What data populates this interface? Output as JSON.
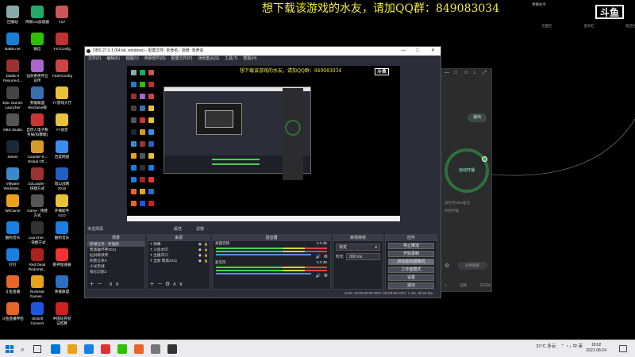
{
  "desktop": {
    "icons": [
      {
        "label": "回收站",
        "col": 0,
        "row": 0,
        "color": "#8aa"
      },
      {
        "label": "网易UU加速器",
        "col": 1,
        "row": 0,
        "color": "#2a6"
      },
      {
        "label": "YS7",
        "col": 2,
        "row": 0,
        "color": "#c55"
      },
      {
        "label": "Battle.net",
        "col": 0,
        "row": 1,
        "color": "#1a7fd4"
      },
      {
        "label": "微信",
        "col": 1,
        "row": 1,
        "color": "#2dc100"
      },
      {
        "label": "YS7Config",
        "col": 2,
        "row": 1,
        "color": "#b33"
      },
      {
        "label": "Diablo II\nResurrect...",
        "col": 0,
        "row": 2,
        "color": "#933"
      },
      {
        "label": "仙剑奇侠传五\n前传",
        "col": 1,
        "row": 2,
        "color": "#a6c"
      },
      {
        "label": "YSSHConfig",
        "col": 2,
        "row": 2,
        "color": "#c44"
      },
      {
        "label": "Epic Games\nLauncher",
        "col": 0,
        "row": 3,
        "color": "#444"
      },
      {
        "label": "英雄联盟\nWeGame版",
        "col": 1,
        "row": 3,
        "color": "#3a6fb0"
      },
      {
        "label": "YY游戏大厅",
        "col": 2,
        "row": 3,
        "color": "#e8c23a"
      },
      {
        "label": "OBS Studio",
        "col": 0,
        "row": 4,
        "color": "#555"
      },
      {
        "label": "自然人电子税\n务局(扣缴端)",
        "col": 1,
        "row": 4,
        "color": "#c33"
      },
      {
        "label": "YY语音",
        "col": 2,
        "row": 4,
        "color": "#e8c23a"
      },
      {
        "label": "Steam",
        "col": 0,
        "row": 5,
        "color": "#1b2838"
      },
      {
        "label": "Counter-S...\nGlobal Off...",
        "col": 1,
        "row": 5,
        "color": "#d99a2b"
      },
      {
        "label": "百度网盘",
        "col": 2,
        "row": 5,
        "color": "#3b8ef0"
      },
      {
        "label": "VMware\nWorkstati...",
        "col": 0,
        "row": 6,
        "color": "#3a8acb"
      },
      {
        "label": "D2Loader -\n快捷方式",
        "col": 1,
        "row": 6,
        "color": "#933"
      },
      {
        "label": "暗山战网\n2016",
        "col": 2,
        "row": 6,
        "color": "#2060c0"
      },
      {
        "label": "WeGame",
        "col": 0,
        "row": 7,
        "color": "#e8a31a"
      },
      {
        "label": "Game - 快捷\n方式",
        "col": 1,
        "row": 7,
        "color": "#555"
      },
      {
        "label": "开播助手\nV3.0",
        "col": 2,
        "row": 7,
        "color": "#e8c23a"
      },
      {
        "label": "酷狗音乐",
        "col": 0,
        "row": 8,
        "color": "#1a7fe0"
      },
      {
        "label": "Launcher...\n- 快捷方式",
        "col": 1,
        "row": 8,
        "color": "#333"
      },
      {
        "label": "酷狗音乐",
        "col": 2,
        "row": 8,
        "color": "#1a7fe0"
      },
      {
        "label": "钉钉",
        "col": 0,
        "row": 9,
        "color": "#1a7fe0"
      },
      {
        "label": "Red Dead\nRedempt...",
        "col": 1,
        "row": 9,
        "color": "#a22"
      },
      {
        "label": "雷神加速器",
        "col": 2,
        "row": 9,
        "color": "#e33"
      },
      {
        "label": "斗鱼直播",
        "col": 0,
        "row": 10,
        "color": "#e8652a"
      },
      {
        "label": "Rockstar\nGames...",
        "col": 1,
        "row": 10,
        "color": "#e8a31a"
      },
      {
        "label": "英雄联盟",
        "col": 2,
        "row": 10,
        "color": "#2a6fc0"
      },
      {
        "label": "斗鱼直播伴侣",
        "col": 0,
        "row": 11,
        "color": "#e8652a"
      },
      {
        "label": "Ubisoft\nConnect",
        "col": 1,
        "row": 11,
        "color": "#2255dd"
      },
      {
        "label": "中国证券登\n记结算",
        "col": 2,
        "row": 11,
        "color": "#c22"
      }
    ],
    "banner": "想下载该游戏的水友，请加QQ群：849083034",
    "sidebar": {
      "title": "弹幕助手",
      "links": [
        "页面栏",
        "查询栏",
        "粘连栏"
      ]
    },
    "logo": "斗鱼"
  },
  "side_panel": {
    "controls": [
      "—",
      "□",
      "☺",
      "♪",
      "⤢"
    ],
    "exit_button": "退出",
    "start_button": "自动开播",
    "sub1": "请打开OBS推流",
    "sub2": "开始开播",
    "share_button": "分享链接",
    "footer": [
      "≡",
      "提醒",
      "开开始"
    ]
  },
  "obs": {
    "title": "OBS 27.0.1 (64-bit, windows) - 配置文件: 未命名 - 场景: 未命名",
    "window_controls": [
      "—",
      "□",
      "✕"
    ],
    "menu": [
      "文件(F)",
      "编辑(E)",
      "视图(V)",
      "停靠部件(D)",
      "配置文件(P)",
      "场景集合(S)",
      "工具(T)",
      "帮助(H)"
    ],
    "preview_banner": "想下载该游戏的水友，请加QQ群：849083034",
    "preview_logo": "斗鱼",
    "midbar": {
      "label": "未选择源",
      "properties": "属性",
      "filters": "滤镜"
    },
    "scenes": {
      "header": "场景",
      "items": [
        "斩眼任务 - 英雄版",
        "暗黑破坏神2011",
        "仙剑奇侠传",
        "刺客信条3",
        "小米无线",
        "绯红幻影2"
      ],
      "selected": 0
    },
    "sources": {
      "header": "来源",
      "items": [
        "弹幕",
        "斗鱼水印",
        "主播开口",
        "全屏 暗黑2011"
      ],
      "selected": -1
    },
    "mixer": {
      "header": "混音器",
      "rows": [
        {
          "name": "桌面音频",
          "db": "0.0 dB"
        },
        {
          "name": "麦克风",
          "db": "0.0 dB"
        }
      ]
    },
    "transitions": {
      "header": "转场特效",
      "type": "渐变",
      "duration_label": "时长",
      "duration": "300 ms"
    },
    "controls": {
      "header": "控件",
      "buttons": [
        "停止推流",
        "开始录制",
        "启动虚拟摄像机",
        "工作室模式",
        "设置",
        "退出"
      ],
      "highlight": 2
    },
    "status": "LIVE: 12:00:00:00   REC: 00:00:00   CPU: 1.4%, 30.00 fps"
  },
  "taskbar": {
    "apps": [
      "#0078d4",
      "#e8a31a",
      "#1a7fe0",
      "#d33",
      "#2dc100",
      "#e8652a",
      "#777",
      "#333"
    ],
    "temp": "31°C 多云",
    "time": "18:02",
    "date": "2021-08-24"
  }
}
